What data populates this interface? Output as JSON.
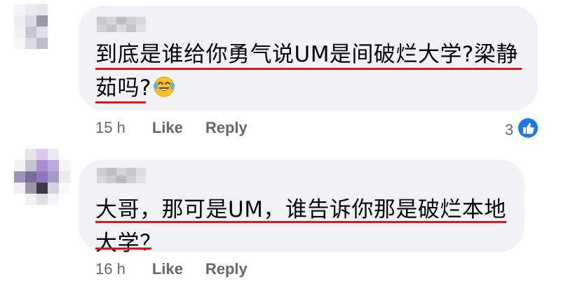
{
  "comments": [
    {
      "text_line1": "到底是谁给你勇气说UM是间破烂大学?梁静",
      "text_line2": "茹吗?",
      "time": "15 h",
      "like_label": "Like",
      "reply_label": "Reply",
      "reaction_count": "3",
      "emoji": "laughing-tears-emoji"
    },
    {
      "text_line1": "大哥，那可是UM，谁告诉你那是破烂本地",
      "text_line2": "大学？",
      "time": "16 h",
      "like_label": "Like",
      "reply_label": "Reply"
    }
  ],
  "colors": {
    "bubble": "#f0f2f5",
    "underline": "#e3121c",
    "meta_text": "#65676b",
    "like_blue": "#1877f2"
  }
}
